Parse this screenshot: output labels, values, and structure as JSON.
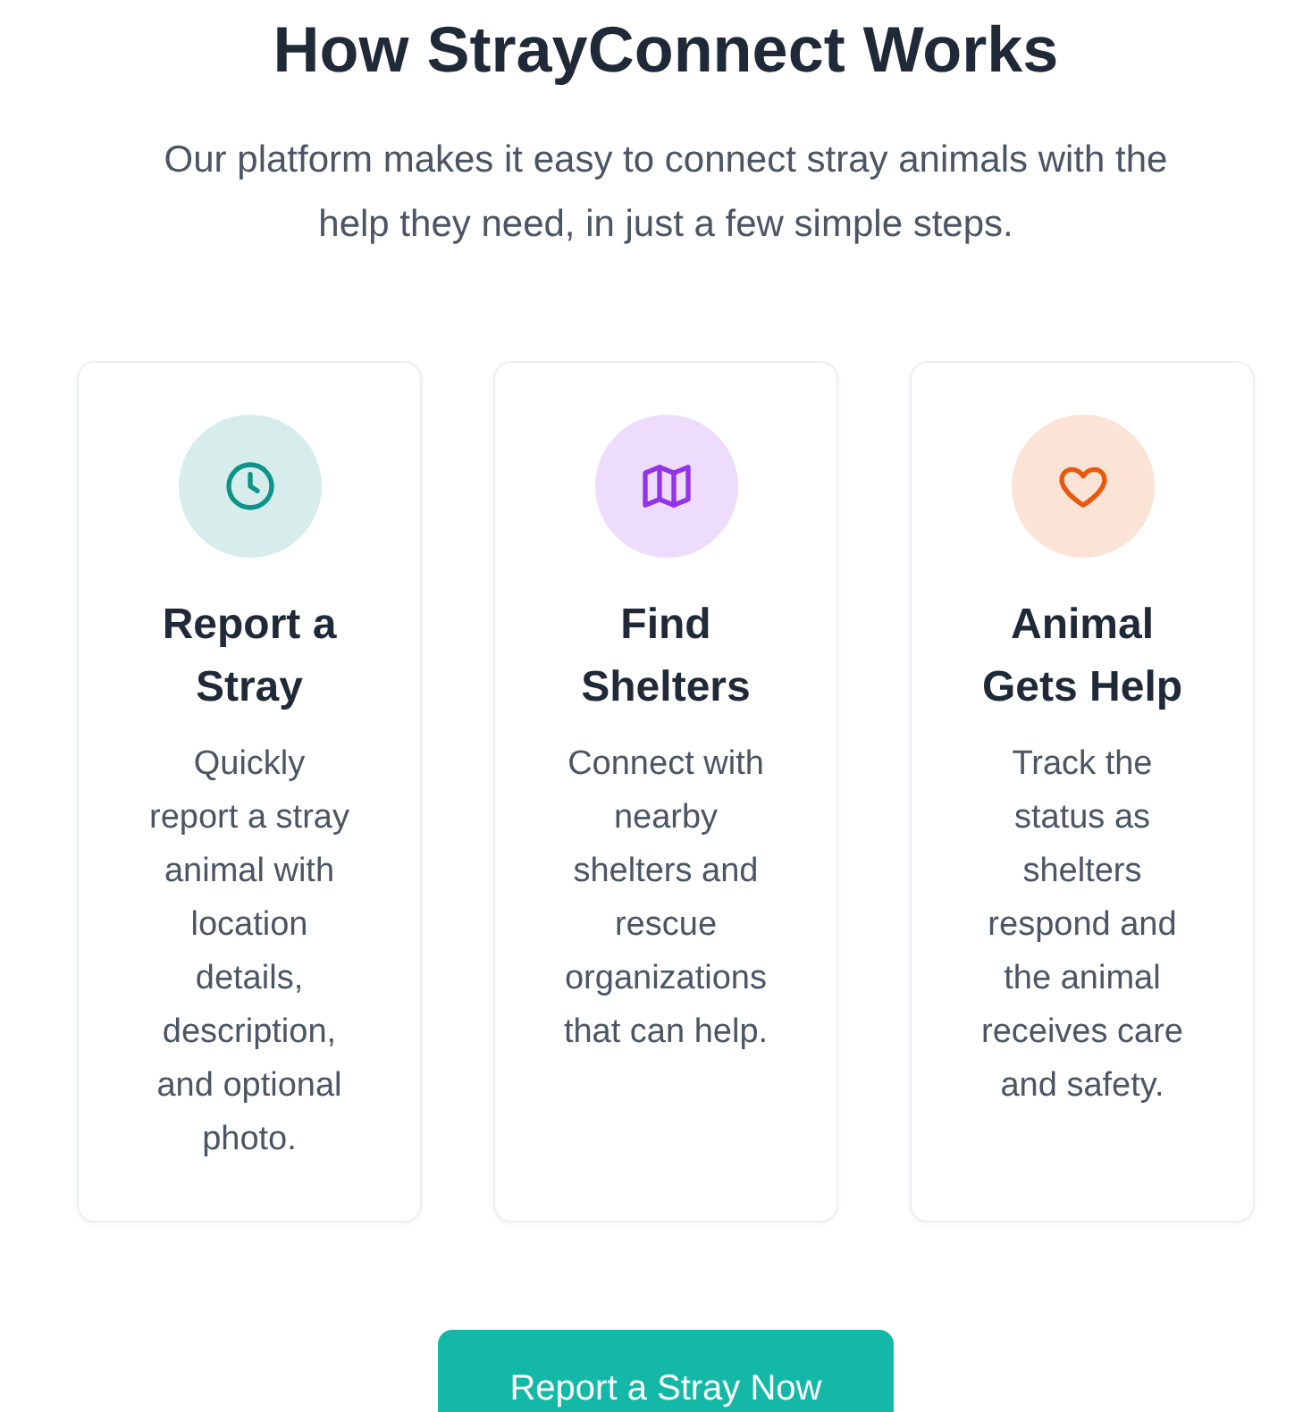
{
  "section": {
    "title": "How StrayConnect Works",
    "subtitle": "Our platform makes it easy to connect stray animals with the help they need, in just a few simple steps."
  },
  "steps": [
    {
      "kind": "clock",
      "color": "#0d9488",
      "title": "Report a Stray",
      "description": "Quickly report a stray animal with location details, description, and optional photo."
    },
    {
      "kind": "map",
      "color": "#9333ea",
      "title": "Find Shelters",
      "description": "Connect with nearby shelters and rescue organizations that can help."
    },
    {
      "kind": "heart",
      "color": "#ea580c",
      "title": "Animal Gets Help",
      "description": "Track the status as shelters respond and the animal receives care and safety."
    }
  ],
  "cta_button": {
    "label": "Report a Stray Now"
  }
}
